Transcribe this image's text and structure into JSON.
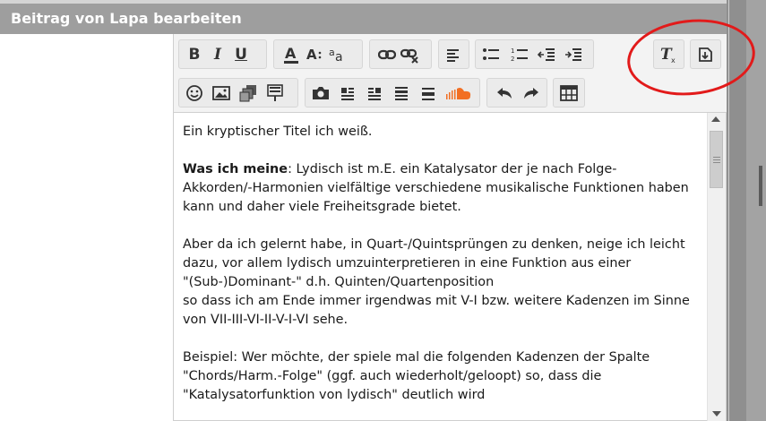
{
  "dialog": {
    "title": "Beitrag von Lapa bearbeiten"
  },
  "toolbar": {
    "row1": [
      {
        "name": "bold-button",
        "label": "B"
      },
      {
        "name": "italic-button",
        "label": "I"
      },
      {
        "name": "underline-button",
        "label": "U"
      },
      {
        "name": "font-color-button",
        "icon": "font-color-icon"
      },
      {
        "name": "font-size-button",
        "icon": "font-size-icon"
      },
      {
        "name": "font-family-button",
        "icon": "font-family-icon"
      },
      {
        "name": "insert-link-button",
        "icon": "link-icon"
      },
      {
        "name": "remove-link-button",
        "icon": "unlink-icon"
      },
      {
        "name": "align-button",
        "icon": "align-left-icon"
      },
      {
        "name": "bullet-list-button",
        "icon": "bullet-list-icon"
      },
      {
        "name": "numbered-list-button",
        "icon": "numbered-list-icon"
      },
      {
        "name": "outdent-button",
        "icon": "outdent-icon"
      },
      {
        "name": "indent-button",
        "icon": "indent-icon"
      },
      {
        "name": "remove-format-button",
        "icon": "clear-format-icon"
      },
      {
        "name": "toggle-bbcode-button",
        "icon": "bbcode-toggle-icon"
      }
    ],
    "row2": [
      {
        "name": "smilies-button",
        "icon": "smiley-icon"
      },
      {
        "name": "insert-image-button",
        "icon": "image-icon"
      },
      {
        "name": "insert-media-button",
        "icon": "media-icon"
      },
      {
        "name": "insert-gallery-button",
        "icon": "gallery-icon"
      },
      {
        "name": "camera-button",
        "icon": "camera-icon"
      },
      {
        "name": "layout-1-button",
        "icon": "layout-icon"
      },
      {
        "name": "layout-2-button",
        "icon": "layout-icon"
      },
      {
        "name": "layout-3-button",
        "icon": "layout-icon"
      },
      {
        "name": "layout-4-button",
        "icon": "layout-icon"
      },
      {
        "name": "soundcloud-button",
        "icon": "soundcloud-icon"
      },
      {
        "name": "undo-button",
        "icon": "undo-icon"
      },
      {
        "name": "redo-button",
        "icon": "redo-icon"
      },
      {
        "name": "insert-table-button",
        "icon": "table-icon"
      }
    ]
  },
  "content": {
    "line1": "Ein kryptischer Titel ich weiß.",
    "p2_bold": "Was ich meine",
    "p2_rest": ": Lydisch ist m.E. ein Katalysator der je nach Folge-",
    "p2_l2": "Akkorden/-Harmonien vielfältige verschiedene musikalische Funktionen haben",
    "p2_l3": "kann und daher viele Freiheitsgrade bietet.",
    "p3_l1": "Aber da ich gelernt habe, in Quart-/Quintsprüngen zu denken, neige ich leicht",
    "p3_l2": "dazu, vor allem lydisch umzuinterpretieren in eine Funktion aus einer",
    "p3_l3": "\"(Sub-)Dominant-\" d.h. Quinten/Quartenposition",
    "p3_l4": "so dass ich am Ende immer irgendwas mit V-I bzw. weitere Kadenzen im Sinne",
    "p3_l5": "von VII-III-VI-II-V-I-VI sehe.",
    "p4_l1": "Beispiel: Wer möchte, der spiele mal die folgenden Kadenzen der Spalte",
    "p4_l2": "\"Chords/Harm.-Folge\" (ggf. auch wiederholt/geloopt) so, dass die",
    "p4_l3": "\"Katalysatorfunktion von lydisch\" deutlich wird"
  },
  "colors": {
    "titlebar": "#9e9e9e",
    "annotation": "#e21a1a",
    "soundcloud": "#f26f23"
  }
}
